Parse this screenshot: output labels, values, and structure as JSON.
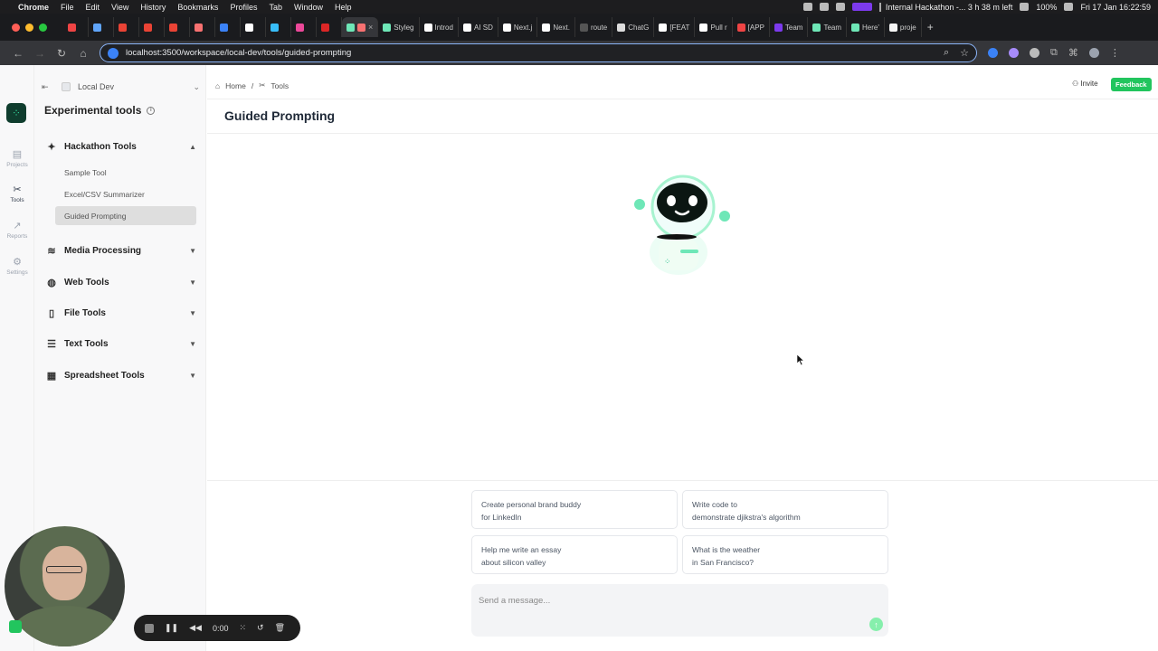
{
  "menubar": {
    "app": "Chrome",
    "items": [
      "File",
      "Edit",
      "View",
      "History",
      "Bookmarks",
      "Profiles",
      "Tab",
      "Window",
      "Help"
    ],
    "status": "Internal Hackathon -... 3 h 38 m left",
    "battery": "100%",
    "clock": "Fri 17 Jan  16:22:59"
  },
  "tabs": [
    "Styleg",
    "Introd",
    "AI SD",
    "Next.j",
    "Next.",
    "route",
    "ChatG",
    "[FEAT",
    "Pull r",
    "[APP",
    "Team",
    "Team",
    "Here'",
    "proje"
  ],
  "browser": {
    "url": "localhost:3500/workspace/local-dev/tools/guided-prompting"
  },
  "sidebar": {
    "workspace": "Local Dev",
    "header": "Experimental tools",
    "groups": [
      {
        "label": "Hackathon Tools",
        "expanded": true,
        "items": [
          "Sample Tool",
          "Excel/CSV Summarizer",
          "Guided Prompting"
        ]
      },
      {
        "label": "Media Processing"
      },
      {
        "label": "Web Tools"
      },
      {
        "label": "File Tools"
      },
      {
        "label": "Text Tools"
      },
      {
        "label": "Spreadsheet Tools"
      }
    ]
  },
  "rail": [
    {
      "label": "Projects",
      "icon": "layers-icon"
    },
    {
      "label": "Tools",
      "icon": "tools-icon"
    },
    {
      "label": "Reports",
      "icon": "chart-icon"
    },
    {
      "label": "Settings",
      "icon": "gear-icon"
    }
  ],
  "breadcrumb": {
    "home": "Home",
    "separator": "/",
    "current": "Tools"
  },
  "header": {
    "invite": "Invite",
    "feedback": "Feedback"
  },
  "page": {
    "title": "Guided Prompting"
  },
  "suggestions": [
    {
      "line1": "Create personal brand buddy",
      "line2": "for LinkedIn"
    },
    {
      "line1": "Write code to",
      "line2": "demonstrate djikstra's algorithm"
    },
    {
      "line1": "Help me write an essay",
      "line2": "about silicon valley"
    },
    {
      "line1": "What is the weather",
      "line2": "in San Francisco?"
    }
  ],
  "composer": {
    "placeholder": "Send a message..."
  },
  "recorder": {
    "time": "0:00"
  },
  "colors": {
    "accent": "#22c55e",
    "sidebar_bg": "#f8f8f9",
    "active_item": "#dedede"
  }
}
